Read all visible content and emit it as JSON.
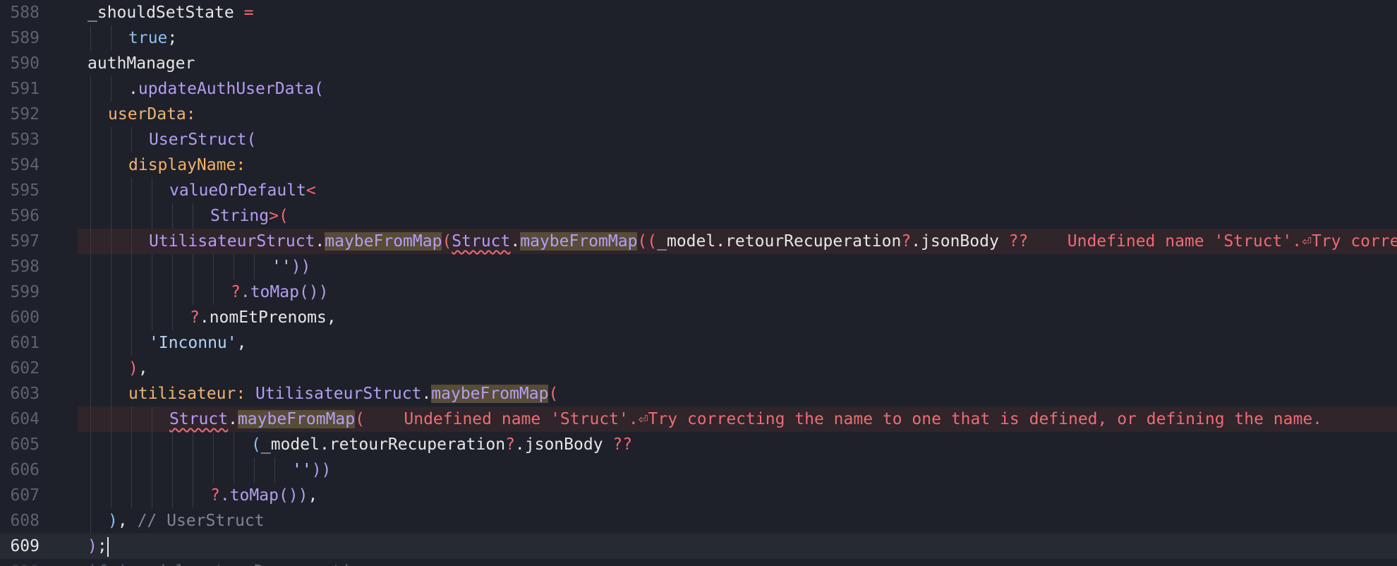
{
  "editor": {
    "colors": {
      "background": "#1e2129",
      "gutter_text": "#5c6370",
      "plain": "#e6e6e6",
      "field": "#c8ccd4",
      "keyword": "#8fbdf0",
      "method": "#b39df3",
      "named_arg": "#f1b26d",
      "operator": "#ef6b73",
      "string": "#b3d2f7",
      "comment": "#7f8692",
      "error": "#ef6b73",
      "error_line_bg": "#2f252b",
      "match_highlight": "#574c36",
      "current_line_bg": "#262a33",
      "indent_guide": "#383c46"
    },
    "lines": [
      {
        "num": "588",
        "indent": 0,
        "segments": [
          {
            "t": "_shouldSetState ",
            "c": "plain"
          },
          {
            "t": "=",
            "c": "operator"
          }
        ]
      },
      {
        "num": "589",
        "indent": 2,
        "segments": [
          {
            "t": "true",
            "c": "keyword"
          },
          {
            "t": ";",
            "c": "plain"
          }
        ]
      },
      {
        "num": "590",
        "indent": 0,
        "segments": [
          {
            "t": "authManager",
            "c": "plain"
          }
        ]
      },
      {
        "num": "591",
        "indent": 2,
        "segments": [
          {
            "t": ".",
            "c": "plain"
          },
          {
            "t": "updateAuthUserData(",
            "c": "method"
          }
        ]
      },
      {
        "num": "592",
        "indent": 1,
        "segments": [
          {
            "t": "userData:",
            "c": "named_arg"
          }
        ]
      },
      {
        "num": "593",
        "indent": 3,
        "segments": [
          {
            "t": "UserStruct(",
            "c": "method"
          }
        ]
      },
      {
        "num": "594",
        "indent": 2,
        "segments": [
          {
            "t": "displayName:",
            "c": "named_arg"
          }
        ]
      },
      {
        "num": "595",
        "indent": 4,
        "segments": [
          {
            "t": "valueOrDefault",
            "c": "method"
          },
          {
            "t": "<",
            "c": "operator"
          }
        ]
      },
      {
        "num": "596",
        "indent": 6,
        "segments": [
          {
            "t": "String",
            "c": "method"
          },
          {
            "t": ">(",
            "c": "operator"
          }
        ]
      },
      {
        "num": "597",
        "indent": 3,
        "error": true,
        "segments": [
          {
            "t": "UtilisateurStruct",
            "c": "method"
          },
          {
            "t": ".",
            "c": "plain"
          },
          {
            "t": "maybeFromMap",
            "c": "method",
            "hl": true
          },
          {
            "t": "(",
            "c": "operator"
          },
          {
            "t": "Struct",
            "c": "method",
            "err": true
          },
          {
            "t": ".",
            "c": "plain"
          },
          {
            "t": "maybeFromMap",
            "c": "method",
            "hl": true
          },
          {
            "t": "((",
            "c": "operator"
          },
          {
            "t": "_model",
            "c": "plain"
          },
          {
            "t": ".",
            "c": "plain"
          },
          {
            "t": "retourRecuperation",
            "c": "plain"
          },
          {
            "t": "?",
            "c": "operator"
          },
          {
            "t": ".jsonBody ",
            "c": "plain"
          },
          {
            "t": "??",
            "c": "operator"
          },
          {
            "t": "    ",
            "c": "plain"
          },
          {
            "t": "Undefined name 'Struct'.⏎Try correcting the name to one that is defined, or defining the name.",
            "c": "error"
          }
        ]
      },
      {
        "num": "598",
        "indent": 9,
        "segments": [
          {
            "t": "''",
            "c": "string"
          },
          {
            "t": "))",
            "c": "method"
          }
        ]
      },
      {
        "num": "599",
        "indent": 7,
        "segments": [
          {
            "t": "?",
            "c": "operator"
          },
          {
            "t": ".toMap())",
            "c": "method"
          }
        ]
      },
      {
        "num": "600",
        "indent": 5,
        "segments": [
          {
            "t": "?",
            "c": "operator"
          },
          {
            "t": ".nomEtPrenoms,",
            "c": "plain"
          }
        ]
      },
      {
        "num": "601",
        "indent": 3,
        "segments": [
          {
            "t": "'Inconnu'",
            "c": "string"
          },
          {
            "t": ",",
            "c": "plain"
          }
        ]
      },
      {
        "num": "602",
        "indent": 2,
        "segments": [
          {
            "t": ")",
            "c": "operator"
          },
          {
            "t": ",",
            "c": "plain"
          }
        ]
      },
      {
        "num": "603",
        "indent": 2,
        "segments": [
          {
            "t": "utilisateur:",
            "c": "named_arg"
          },
          {
            "t": " ",
            "c": "plain"
          },
          {
            "t": "UtilisateurStruct",
            "c": "method"
          },
          {
            "t": ".",
            "c": "plain"
          },
          {
            "t": "maybeFromMap",
            "c": "method",
            "hl": true
          },
          {
            "t": "(",
            "c": "operator"
          }
        ]
      },
      {
        "num": "604",
        "indent": 4,
        "error": true,
        "segments": [
          {
            "t": "Struct",
            "c": "method",
            "err": true
          },
          {
            "t": ".",
            "c": "plain"
          },
          {
            "t": "maybeFromMap",
            "c": "method",
            "hl": true
          },
          {
            "t": "(",
            "c": "operator"
          },
          {
            "t": "    ",
            "c": "plain"
          },
          {
            "t": "Undefined name 'Struct'.⏎Try correcting the name to one that is defined, or defining the name.",
            "c": "error"
          }
        ]
      },
      {
        "num": "605",
        "indent": 8,
        "segments": [
          {
            "t": "(",
            "c": "keyword"
          },
          {
            "t": "_model",
            "c": "plain"
          },
          {
            "t": ".",
            "c": "plain"
          },
          {
            "t": "retourRecuperation",
            "c": "plain"
          },
          {
            "t": "?",
            "c": "operator"
          },
          {
            "t": ".jsonBody ",
            "c": "plain"
          },
          {
            "t": "??",
            "c": "operator"
          }
        ]
      },
      {
        "num": "606",
        "indent": 10,
        "segments": [
          {
            "t": "''",
            "c": "string"
          },
          {
            "t": "))",
            "c": "method"
          }
        ]
      },
      {
        "num": "607",
        "indent": 6,
        "segments": [
          {
            "t": "?",
            "c": "operator"
          },
          {
            "t": ".toMap()",
            "c": "method"
          },
          {
            "t": ")",
            "c": "method"
          },
          {
            "t": ",",
            "c": "plain"
          }
        ]
      },
      {
        "num": "608",
        "indent": 1,
        "segments": [
          {
            "t": ")",
            "c": "keyword"
          },
          {
            "t": ", ",
            "c": "plain"
          },
          {
            "t": "// UserStruct",
            "c": "comment"
          }
        ]
      },
      {
        "num": "609",
        "indent": 0,
        "current": true,
        "cursor": true,
        "segments": [
          {
            "t": ")",
            "c": "method"
          },
          {
            "t": ";",
            "c": "plain"
          }
        ]
      },
      {
        "num": "610",
        "indent": 0,
        "ghost": true,
        "segments": [
          {
            "t": "if (",
            "c": "keyword"
          },
          {
            "t": "_model",
            "c": "plain"
          },
          {
            "t": ".",
            "c": "plain"
          },
          {
            "t": "retourRecuperation",
            "c": "plain"
          }
        ]
      }
    ]
  }
}
